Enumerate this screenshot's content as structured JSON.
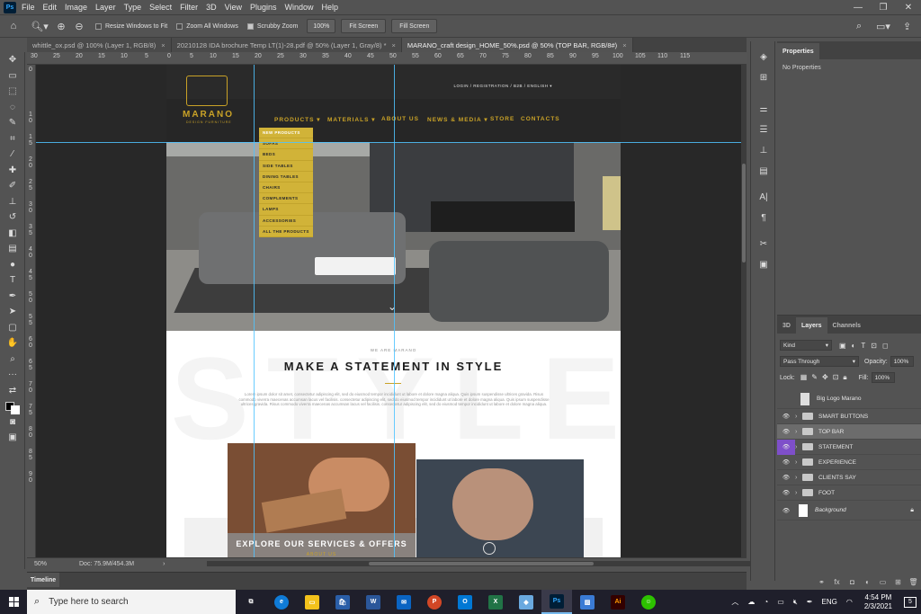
{
  "menubar": {
    "logo": "Ps",
    "items": [
      "File",
      "Edit",
      "Image",
      "Layer",
      "Type",
      "Select",
      "Filter",
      "3D",
      "View",
      "Plugins",
      "Window",
      "Help"
    ],
    "minimize": "—",
    "maximize": "❐",
    "close": "✕"
  },
  "options": {
    "resize_windows": "Resize Windows to Fit",
    "zoom_all": "Zoom All Windows",
    "scrubby_zoom": "Scrubby Zoom",
    "zoom_value": "100%",
    "fit_screen": "Fit Screen",
    "fill_screen": "Fill Screen"
  },
  "tabs": [
    {
      "label": "whittle_ox.psd @ 100% (Layer 1, RGB/8)"
    },
    {
      "label": "20210128 IDA brochure Temp LT(1)-28.pdf @ 50% (Layer 1, Gray/8) *"
    },
    {
      "label": "MARANO_craft design_HOME_50%.psd @ 50% (TOP BAR, RGB/8#)"
    }
  ],
  "ruler": {
    "top": [
      "30",
      "25",
      "20",
      "15",
      "10",
      "5",
      "0",
      "5",
      "10",
      "15",
      "20",
      "25",
      "30",
      "35",
      "40",
      "45",
      "50",
      "55",
      "60",
      "65",
      "70",
      "75",
      "80",
      "85",
      "90",
      "95",
      "100",
      "105",
      "110",
      "115"
    ],
    "left": [
      "0",
      "1\n0",
      "1\n5",
      "2\n0",
      "2\n5",
      "3\n0",
      "3\n5",
      "4\n0",
      "4\n5",
      "5\n0",
      "5\n5",
      "6\n0",
      "6\n5",
      "7\n0",
      "7\n5",
      "8\n0",
      "8\n5",
      "9\n0"
    ]
  },
  "site": {
    "logo_name": "MARANO",
    "logo_sub": "DESIGN FURNITURE",
    "top_meta": "LOGIN / REGISTRATION  /  B2B  /  ENGLISH ▾",
    "nav": [
      "PRODUCTS ▾",
      "MATERIALS ▾",
      "ABOUT US",
      "NEWS & MEDIA ▾",
      "STORE",
      "CONTACTS"
    ],
    "dropdown": [
      "NEW PRODUCTS",
      "SOFAS",
      "BEDS",
      "SIDE TABLES",
      "DINING TABLES",
      "CHAIRS",
      "COMPLEMENTS",
      "LAMPS",
      "ACCESSORIES",
      "ALL THE PRODUCTS"
    ],
    "eyebrow": "WE ARE MARANO",
    "heading": "MAKE A STATEMENT IN STYLE",
    "paragraph": "Lorem ipsum dolor sit amet, consectetur adipiscing elit, sed do eiusmod tempor incididunt ut labore et dolore magna aliqua. Quis ipsum suspendisse ultrices gravida. Risus commodo viverra maecenas accumsan lacus vel facilisis. consectetur adipiscing elit, sed do eiusmod tempor incididunt ut labore et dolore magna aliqua. Quis ipsum suspendisse ultrices gravida. Risus commodo viverra maecenas accumsan lacus vel facilisis. consectetur adipiscing elit, sed do eiusmod tempor incididunt ut labore et dolore magna aliqua.",
    "bg_word": "STYLE",
    "cta": "EXPLORE OUR SERVICES & OFFERS",
    "cta_sub": "ABOUT US",
    "chevron": "⌄"
  },
  "status": {
    "zoom": "50%",
    "doc": "Doc: 75.9M/454.3M",
    "arrow": "›"
  },
  "timeline": {
    "label": "Timeline"
  },
  "properties": {
    "tab": "Properties",
    "empty": "No Properties"
  },
  "layers_panel": {
    "tabs": [
      "3D",
      "Layers",
      "Channels"
    ],
    "kind": "Kind",
    "blend": "Pass Through",
    "opacity_label": "Opacity:",
    "opacity": "100%",
    "lock_label": "Lock:",
    "fill_label": "Fill:",
    "fill": "100%",
    "layers": [
      {
        "name": "Big Logo Marano",
        "type": "smart",
        "visible": false
      },
      {
        "name": "SMART BUTTONS",
        "type": "group",
        "visible": true
      },
      {
        "name": "TOP BAR",
        "type": "group",
        "visible": true,
        "selected": true
      },
      {
        "name": "STATEMENT",
        "type": "group",
        "visible": true,
        "highlight": true
      },
      {
        "name": "EXPERIENCE",
        "type": "group",
        "visible": true
      },
      {
        "name": "CLIENTS SAY",
        "type": "group",
        "visible": true
      },
      {
        "name": "FOOT",
        "type": "group",
        "visible": true
      },
      {
        "name": "Background",
        "type": "background",
        "visible": true,
        "locked": true
      }
    ]
  },
  "taskbar": {
    "search_placeholder": "Type here to search",
    "time": "4:54 PM",
    "date": "2/3/2021",
    "lang": "ENG",
    "notifications": "5",
    "apps": [
      {
        "label": "⧉",
        "color": "#1f1f2b"
      },
      {
        "label": "e",
        "color": "#0f7bd7"
      },
      {
        "label": "▭",
        "color": "#f3c21b"
      },
      {
        "label": "🛍",
        "color": "#2a5ea8"
      },
      {
        "label": "W",
        "color": "#2b579a"
      },
      {
        "label": "✉",
        "color": "#0a64c2"
      },
      {
        "label": "P",
        "color": "#d24726"
      },
      {
        "label": "O",
        "color": "#0078d4"
      },
      {
        "label": "X",
        "color": "#217346"
      },
      {
        "label": "◆",
        "color": "#6aa9df"
      },
      {
        "label": "Ps",
        "color": "#001e36"
      },
      {
        "label": "▨",
        "color": "#3a7bd5"
      },
      {
        "label": "Ai",
        "color": "#330000"
      },
      {
        "label": "☺",
        "color": "#2dc100"
      }
    ]
  }
}
